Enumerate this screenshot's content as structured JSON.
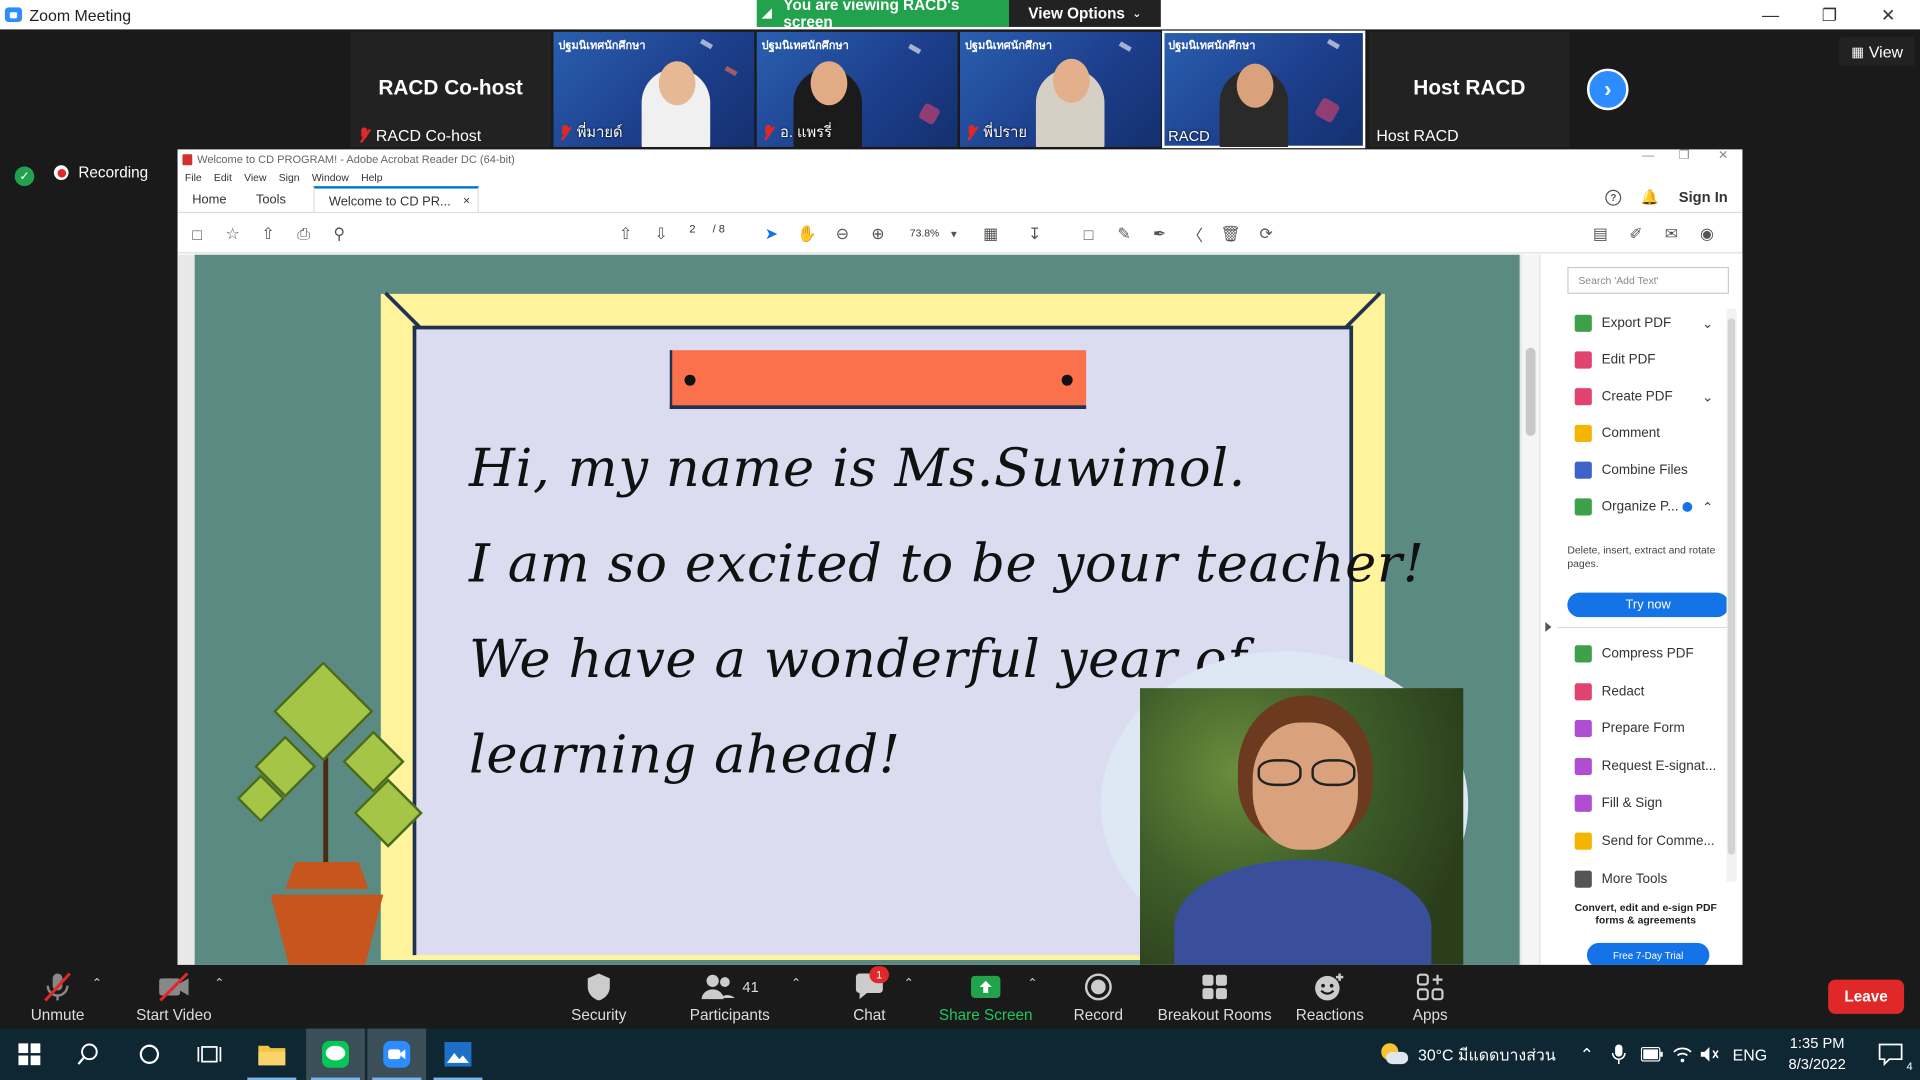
{
  "window": {
    "title": "Zoom Meeting",
    "share_banner": "You are viewing RACD's screen",
    "view_options": "View Options",
    "view_button": "View"
  },
  "participants": [
    {
      "label": "RACD Co-host",
      "caption": "RACD Co-host",
      "muted": true,
      "video": false
    },
    {
      "label": "",
      "caption": "พี่มายด์",
      "muted": true,
      "video": true,
      "banner": "ปฐมนิเทศนักศึกษา"
    },
    {
      "label": "",
      "caption": "อ. แพรรี่",
      "muted": true,
      "video": true,
      "banner": "ปฐมนิเทศนักศึกษา"
    },
    {
      "label": "",
      "caption": "พี่ปราย",
      "muted": true,
      "video": true,
      "banner": "ปฐมนิเทศนักศึกษา"
    },
    {
      "label": "",
      "caption": "RACD",
      "muted": false,
      "video": true,
      "banner": "ปฐมนิเทศนักศึกษา"
    },
    {
      "label": "Host RACD",
      "caption": "Host RACD",
      "muted": false,
      "video": false
    }
  ],
  "status": {
    "recording": "Recording"
  },
  "acrobat": {
    "title": "Welcome to CD PROGRAM! - Adobe Acrobat Reader DC (64-bit)",
    "menu": [
      "File",
      "Edit",
      "View",
      "Sign",
      "Window",
      "Help"
    ],
    "tabs": [
      "Home",
      "Tools"
    ],
    "doc_tab": "Welcome to CD PR...",
    "sign_in": "Sign In",
    "page_current": "2",
    "page_total": "/ 8",
    "zoom": "73.8%",
    "document": {
      "lines": [
        "Hi, my name is Ms.Suwimol.",
        "I am so excited to be your  teacher!",
        "We have a wonderful year of",
        "learning ahead!"
      ]
    },
    "right_panel": {
      "search_placeholder": "Search 'Add Text'",
      "tools": [
        {
          "label": "Export PDF",
          "color": "#3fa04a",
          "chevron": "down"
        },
        {
          "label": "Edit PDF",
          "color": "#e0436e",
          "chevron": ""
        },
        {
          "label": "Create PDF",
          "color": "#e0436e",
          "chevron": "down"
        },
        {
          "label": "Comment",
          "color": "#f5b400",
          "chevron": ""
        },
        {
          "label": "Combine Files",
          "color": "#3d62c8",
          "chevron": ""
        },
        {
          "label": "Organize P...",
          "color": "#3fa04a",
          "chevron": "up"
        }
      ],
      "organize_desc": "Delete, insert, extract and rotate pages.",
      "try_now": "Try now",
      "more_tools": [
        {
          "label": "Compress PDF",
          "color": "#3fa04a"
        },
        {
          "label": "Redact",
          "color": "#e0436e"
        },
        {
          "label": "Prepare Form",
          "color": "#b04ed1"
        },
        {
          "label": "Request E-signat...",
          "color": "#b04ed1"
        },
        {
          "label": "Fill & Sign",
          "color": "#b04ed1"
        },
        {
          "label": "Send for Comme...",
          "color": "#f5b400"
        },
        {
          "label": "More Tools",
          "color": "#555555"
        }
      ],
      "promo": "Convert, edit and e-sign PDF forms & agreements",
      "free_trial": "Free 7-Day Trial"
    }
  },
  "toolbar": {
    "unmute": "Unmute",
    "start_video": "Start Video",
    "security": "Security",
    "participants": "Participants",
    "participants_count": "41",
    "chat": "Chat",
    "chat_badge": "1",
    "share_screen": "Share Screen",
    "record": "Record",
    "breakout": "Breakout Rooms",
    "reactions": "Reactions",
    "apps": "Apps",
    "leave": "Leave"
  },
  "taskbar": {
    "weather": "30°C  มีแดดบางส่วน",
    "language": "ENG",
    "time": "1:35 PM",
    "date": "8/3/2022",
    "notifications": "4"
  }
}
